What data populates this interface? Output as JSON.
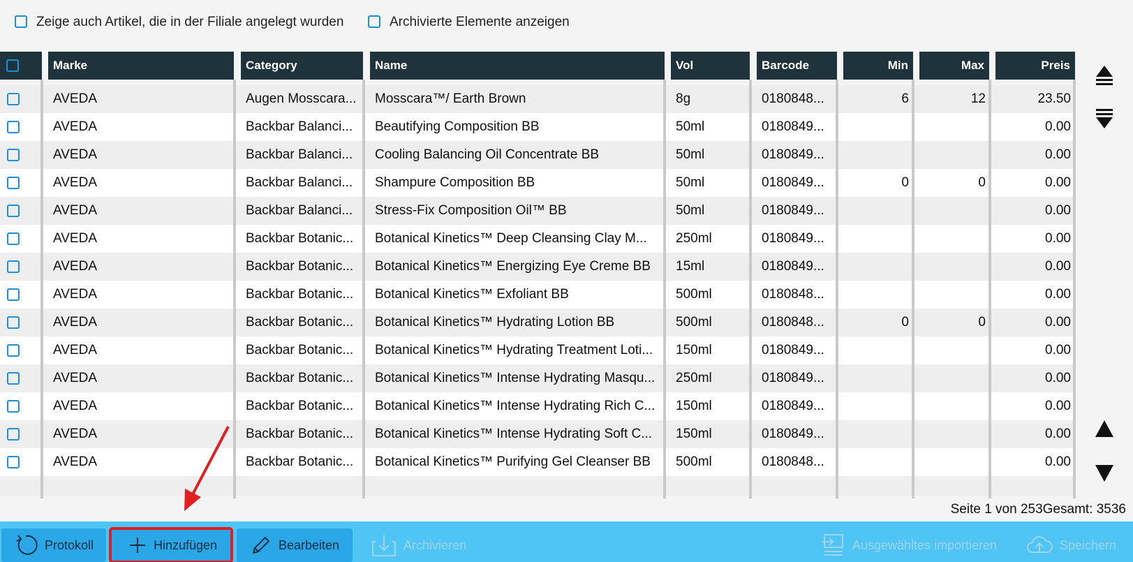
{
  "filters": {
    "show_branch_items": "Zeige auch Artikel, die in der Filiale angelegt wurden",
    "show_archived": "Archivierte Elemente anzeigen"
  },
  "table": {
    "headers": {
      "brand": "Marke",
      "category": "Category",
      "name": "Name",
      "vol": "Vol",
      "barcode": "Barcode",
      "min": "Min",
      "max": "Max",
      "price": "Preis"
    },
    "rows": [
      {
        "brand": "AVEDA",
        "category": "Augen Mosscara...",
        "name": "Mosscara™/ Earth Brown",
        "vol": "8g",
        "barcode": "0180848...",
        "min": "6",
        "max": "12",
        "price": "23.50"
      },
      {
        "brand": "AVEDA",
        "category": "Backbar Balanci...",
        "name": "Beautifying Composition BB",
        "vol": "50ml",
        "barcode": "0180849...",
        "min": "",
        "max": "",
        "price": "0.00"
      },
      {
        "brand": "AVEDA",
        "category": "Backbar Balanci...",
        "name": "Cooling Balancing Oil Concentrate BB",
        "vol": "50ml",
        "barcode": "0180849...",
        "min": "",
        "max": "",
        "price": "0.00"
      },
      {
        "brand": "AVEDA",
        "category": "Backbar Balanci...",
        "name": "Shampure Composition BB",
        "vol": "50ml",
        "barcode": "0180849...",
        "min": "0",
        "max": "0",
        "price": "0.00"
      },
      {
        "brand": "AVEDA",
        "category": "Backbar Balanci...",
        "name": "Stress-Fix Composition Oil™ BB",
        "vol": "50ml",
        "barcode": "0180849...",
        "min": "",
        "max": "",
        "price": "0.00"
      },
      {
        "brand": "AVEDA",
        "category": "Backbar Botanic...",
        "name": "Botanical Kinetics™ Deep Cleansing Clay M...",
        "vol": "250ml",
        "barcode": "0180849...",
        "min": "",
        "max": "",
        "price": "0.00"
      },
      {
        "brand": "AVEDA",
        "category": "Backbar Botanic...",
        "name": "Botanical Kinetics™ Energizing Eye Creme BB",
        "vol": "15ml",
        "barcode": "0180849...",
        "min": "",
        "max": "",
        "price": "0.00"
      },
      {
        "brand": "AVEDA",
        "category": "Backbar Botanic...",
        "name": "Botanical Kinetics™ Exfoliant BB",
        "vol": "500ml",
        "barcode": "0180848...",
        "min": "",
        "max": "",
        "price": "0.00"
      },
      {
        "brand": "AVEDA",
        "category": "Backbar Botanic...",
        "name": "Botanical Kinetics™ Hydrating Lotion BB",
        "vol": "500ml",
        "barcode": "0180848...",
        "min": "0",
        "max": "0",
        "price": "0.00"
      },
      {
        "brand": "AVEDA",
        "category": "Backbar Botanic...",
        "name": "Botanical Kinetics™ Hydrating Treatment Loti...",
        "vol": "150ml",
        "barcode": "0180849...",
        "min": "",
        "max": "",
        "price": "0.00"
      },
      {
        "brand": "AVEDA",
        "category": "Backbar Botanic...",
        "name": "Botanical Kinetics™ Intense Hydrating Masqu...",
        "vol": "250ml",
        "barcode": "0180849...",
        "min": "",
        "max": "",
        "price": "0.00"
      },
      {
        "brand": "AVEDA",
        "category": "Backbar Botanic...",
        "name": "Botanical Kinetics™ Intense Hydrating Rich C...",
        "vol": "150ml",
        "barcode": "0180849...",
        "min": "",
        "max": "",
        "price": "0.00"
      },
      {
        "brand": "AVEDA",
        "category": "Backbar Botanic...",
        "name": "Botanical Kinetics™ Intense Hydrating Soft C...",
        "vol": "150ml",
        "barcode": "0180849...",
        "min": "",
        "max": "",
        "price": "0.00"
      },
      {
        "brand": "AVEDA",
        "category": "Backbar Botanic...",
        "name": "Botanical Kinetics™ Purifying Gel Cleanser BB",
        "vol": "500ml",
        "barcode": "0180848...",
        "min": "",
        "max": "",
        "price": "0.00"
      }
    ]
  },
  "pagination": {
    "page_info": "Seite 1 von 253Gesamt: 3536"
  },
  "toolbar": {
    "protokoll": "Protokoll",
    "add": "Hinzufügen",
    "edit": "Bearbeiten",
    "archive": "Archivieren",
    "import_selected": "Ausgewähltes importieren",
    "save": "Speichern"
  },
  "colors": {
    "header_bg": "#1f333d",
    "toolbar_bg": "#4fc5f5",
    "checkbox": "#1e8fd6",
    "highlight": "#e02020"
  },
  "icons": [
    "scroll-top-icon",
    "scroll-bottom-icon",
    "scroll-up-icon",
    "scroll-down-icon",
    "undo-icon",
    "plus-icon",
    "pencil-icon",
    "archive-icon",
    "import-icon",
    "cloud-upload-icon"
  ]
}
